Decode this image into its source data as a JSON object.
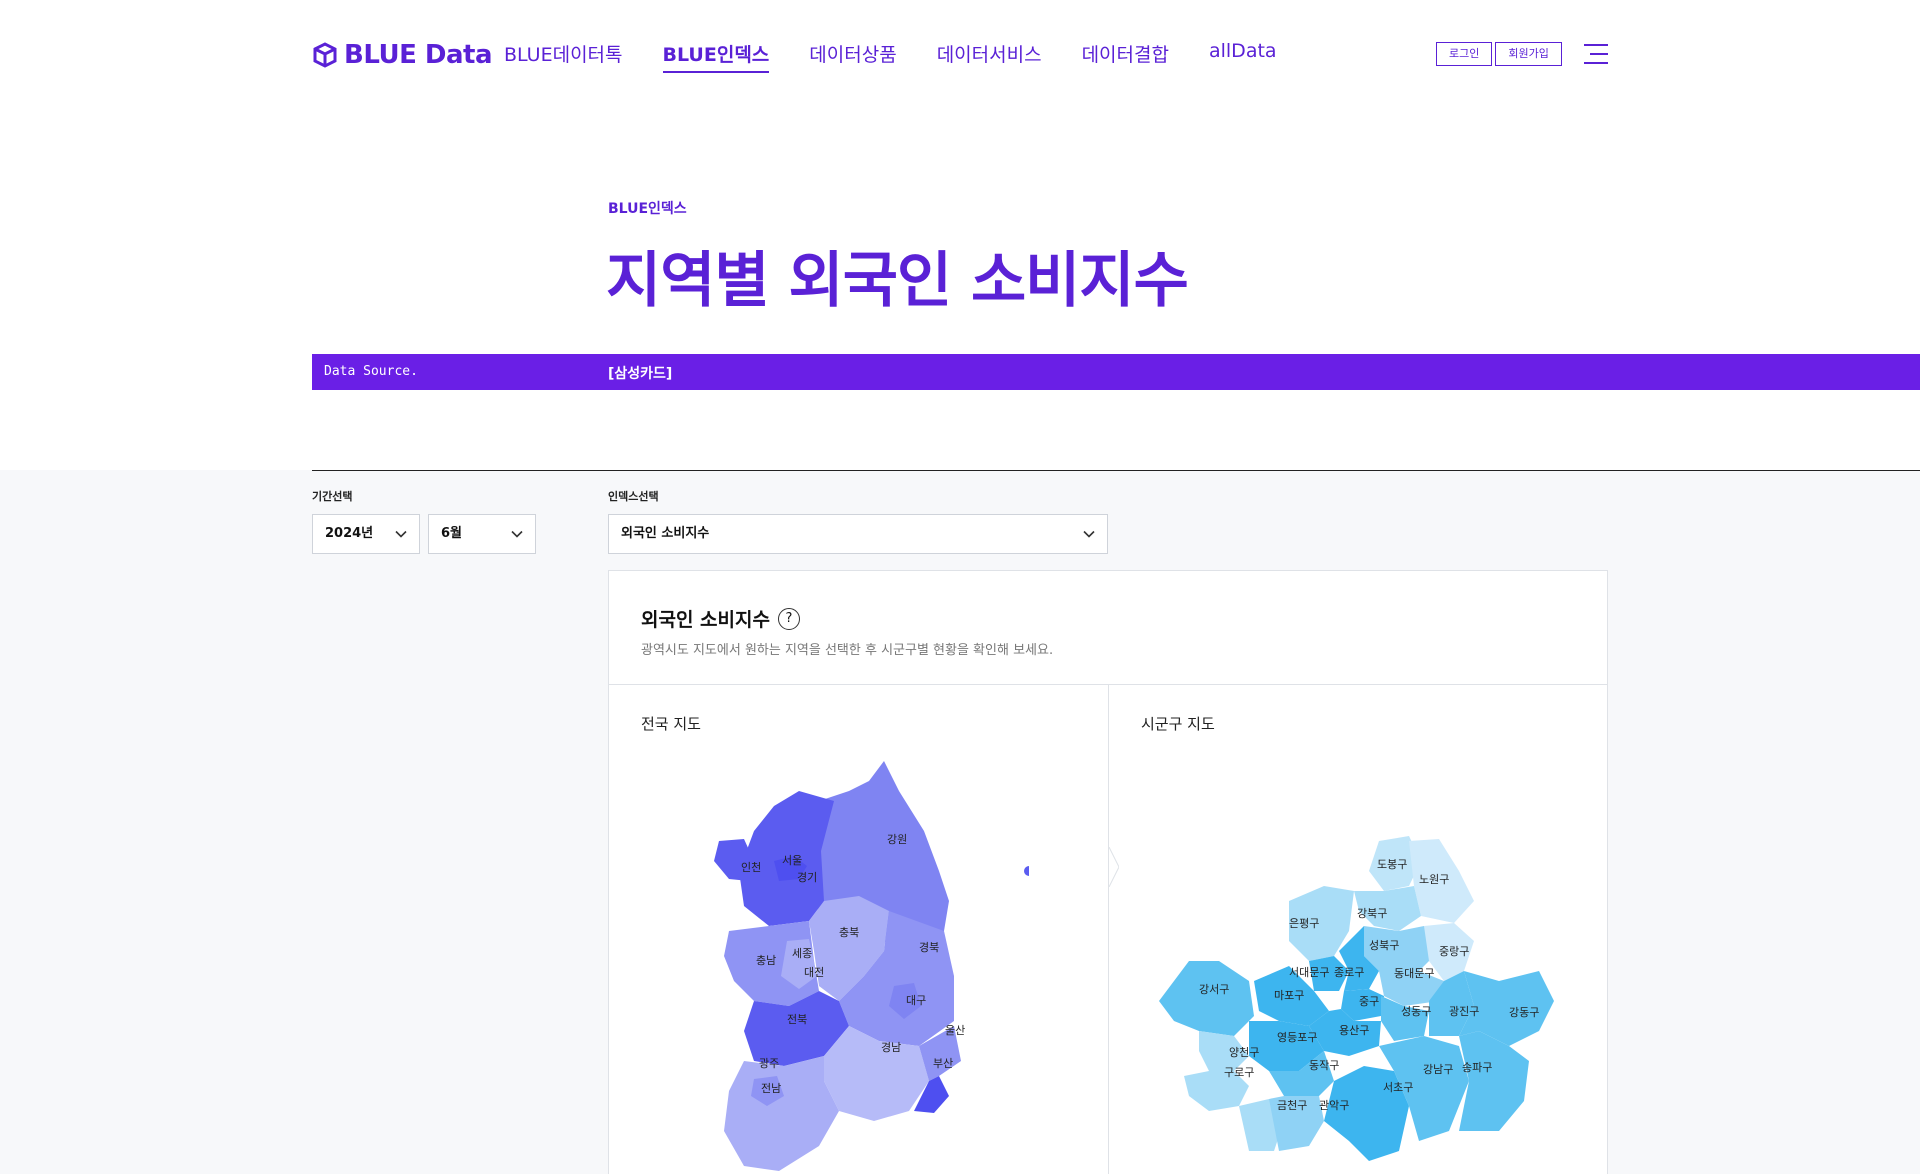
{
  "header": {
    "logo_text": "BLUE Data",
    "nav": [
      {
        "label": "BLUE데이터톡",
        "active": false
      },
      {
        "label": "BLUE인덱스",
        "active": true
      },
      {
        "label": "데이터상품",
        "active": false
      },
      {
        "label": "데이터서비스",
        "active": false
      },
      {
        "label": "데이터결합",
        "active": false
      },
      {
        "label": "allData",
        "active": false
      }
    ],
    "login_label": "로그인",
    "signup_label": "회원가입",
    "menu_icon": "hamburger-menu-icon"
  },
  "hero": {
    "crumb": "BLUE인덱스",
    "title": "지역별 외국인 소비지수",
    "source_label": "Data Source.",
    "source_value": "[삼성카드]"
  },
  "filters": {
    "period_label": "기간선택",
    "year": "2024년",
    "month": "6월",
    "index_label": "인덱스선택",
    "index_value": "외국인 소비지수"
  },
  "card": {
    "title": "외국인 소비지수",
    "help_icon": "question-circle-icon",
    "description": "광역시도 지도에서 원하는 지역을 선택한 후 시군구별 현황을 확인해 보세요.",
    "national_map": {
      "title": "전국 지도",
      "regions": [
        "서울",
        "인천",
        "경기",
        "강원",
        "충북",
        "충남",
        "세종",
        "대전",
        "경북",
        "대구",
        "전북",
        "울산",
        "경남",
        "광주",
        "부산",
        "전남"
      ]
    },
    "district_map": {
      "title": "시군구 지도",
      "districts": [
        "도봉구",
        "노원구",
        "강북구",
        "은평구",
        "성북구",
        "중랑구",
        "서대문구",
        "종로구",
        "동대문구",
        "강서구",
        "마포구",
        "중구",
        "성동구",
        "광진구",
        "강동구",
        "용산구",
        "양천구",
        "영등포구",
        "구로구",
        "동작구",
        "강남구",
        "송파구",
        "서초구",
        "금천구",
        "관악구"
      ]
    }
  },
  "colors": {
    "brand": "#5a21d6",
    "source_bar": "#6a1fe6",
    "map_dark": "#5b5cf0",
    "map_mid": "#7f84f2",
    "map_light": "#a9aef6",
    "district_dark": "#3db5ef",
    "district_light": "#a9ddf7"
  }
}
